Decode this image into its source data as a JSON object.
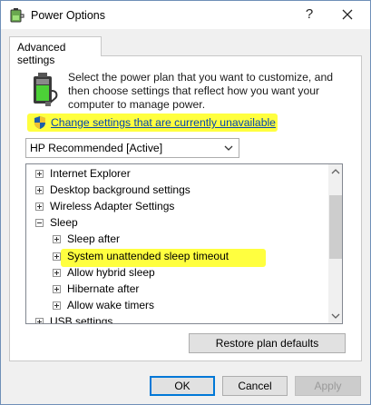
{
  "window": {
    "title": "Power Options",
    "help_glyph": "?",
    "close_glyph": "✕"
  },
  "tabs": [
    {
      "label": "Advanced settings",
      "selected": true
    }
  ],
  "description": "Select the power plan that you want to customize, and then choose settings that reflect how you want your computer to manage power.",
  "change_link": "Change settings that are currently unavailable",
  "plan_select": {
    "value": "HP Recommended [Active]"
  },
  "tree": {
    "items": [
      {
        "label": "Internet Explorer",
        "state": "collapsed",
        "level": 0
      },
      {
        "label": "Desktop background settings",
        "state": "collapsed",
        "level": 0
      },
      {
        "label": "Wireless Adapter Settings",
        "state": "collapsed",
        "level": 0
      },
      {
        "label": "Sleep",
        "state": "expanded",
        "level": 0
      },
      {
        "label": "Sleep after",
        "state": "collapsed",
        "level": 1
      },
      {
        "label": "System unattended sleep timeout",
        "state": "collapsed",
        "level": 1,
        "highlighted": true
      },
      {
        "label": "Allow hybrid sleep",
        "state": "collapsed",
        "level": 1
      },
      {
        "label": "Hibernate after",
        "state": "collapsed",
        "level": 1
      },
      {
        "label": "Allow wake timers",
        "state": "collapsed",
        "level": 1
      },
      {
        "label": "USB settings",
        "state": "collapsed",
        "level": 0
      }
    ]
  },
  "buttons": {
    "restore": "Restore plan defaults",
    "ok": "OK",
    "cancel": "Cancel",
    "apply": "Apply"
  },
  "colors": {
    "highlight": "#ffff3f",
    "link": "#0645ad",
    "focus_border": "#0078d7",
    "disabled_text": "#9a9a9a"
  },
  "icons": {
    "title": "power-options-icon",
    "plan": "battery-plug-icon",
    "link": "uac-shield-icon",
    "dropdown": "chevron-down-icon"
  }
}
